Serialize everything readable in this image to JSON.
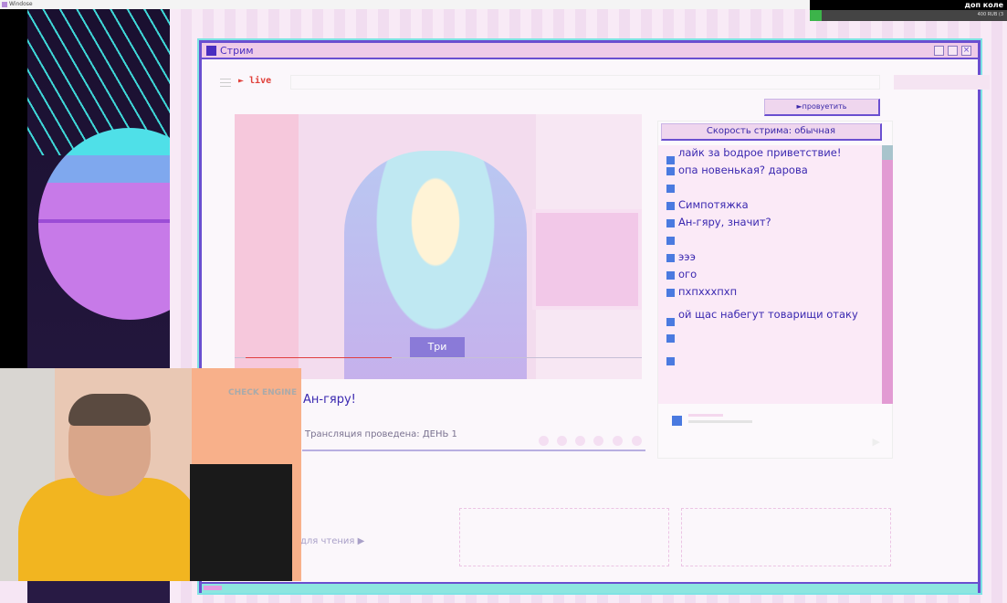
{
  "os": {
    "title": "Windose"
  },
  "overlay": {
    "goal_title": "доп коле",
    "goal_amount": "400 RUB (3",
    "goal_progress": 0.06
  },
  "window": {
    "title": "Стрим"
  },
  "toolbar": {
    "live_label": "► live"
  },
  "skip_button": "►провуетить",
  "game": {
    "choice_label": "Три",
    "dialog_text": "Ан-гяру!",
    "status_text": "Трансляция проведена: ДЕНЬ 1",
    "read_label": "для чтения ▶"
  },
  "chat": {
    "speed_label": "Скорость стрима: обычная",
    "messages": [
      "лайк за bодрое приветствие!",
      "опа новенькая? дарова",
      "",
      "Симпотяжка",
      "Ан-гяру, значит?",
      "",
      "эээ",
      "ого",
      "пхпхххпхп",
      "ой щас набегут товарищи отаку",
      "",
      ""
    ],
    "send_icon": "send-arrow-icon"
  },
  "webcam": {
    "sign_text": "CHECK ENGINE"
  },
  "colors": {
    "accent": "#6a4fd0",
    "chat_text": "#3a28b0",
    "scrollbar": "#e29bd3",
    "live": "#e0403a"
  }
}
